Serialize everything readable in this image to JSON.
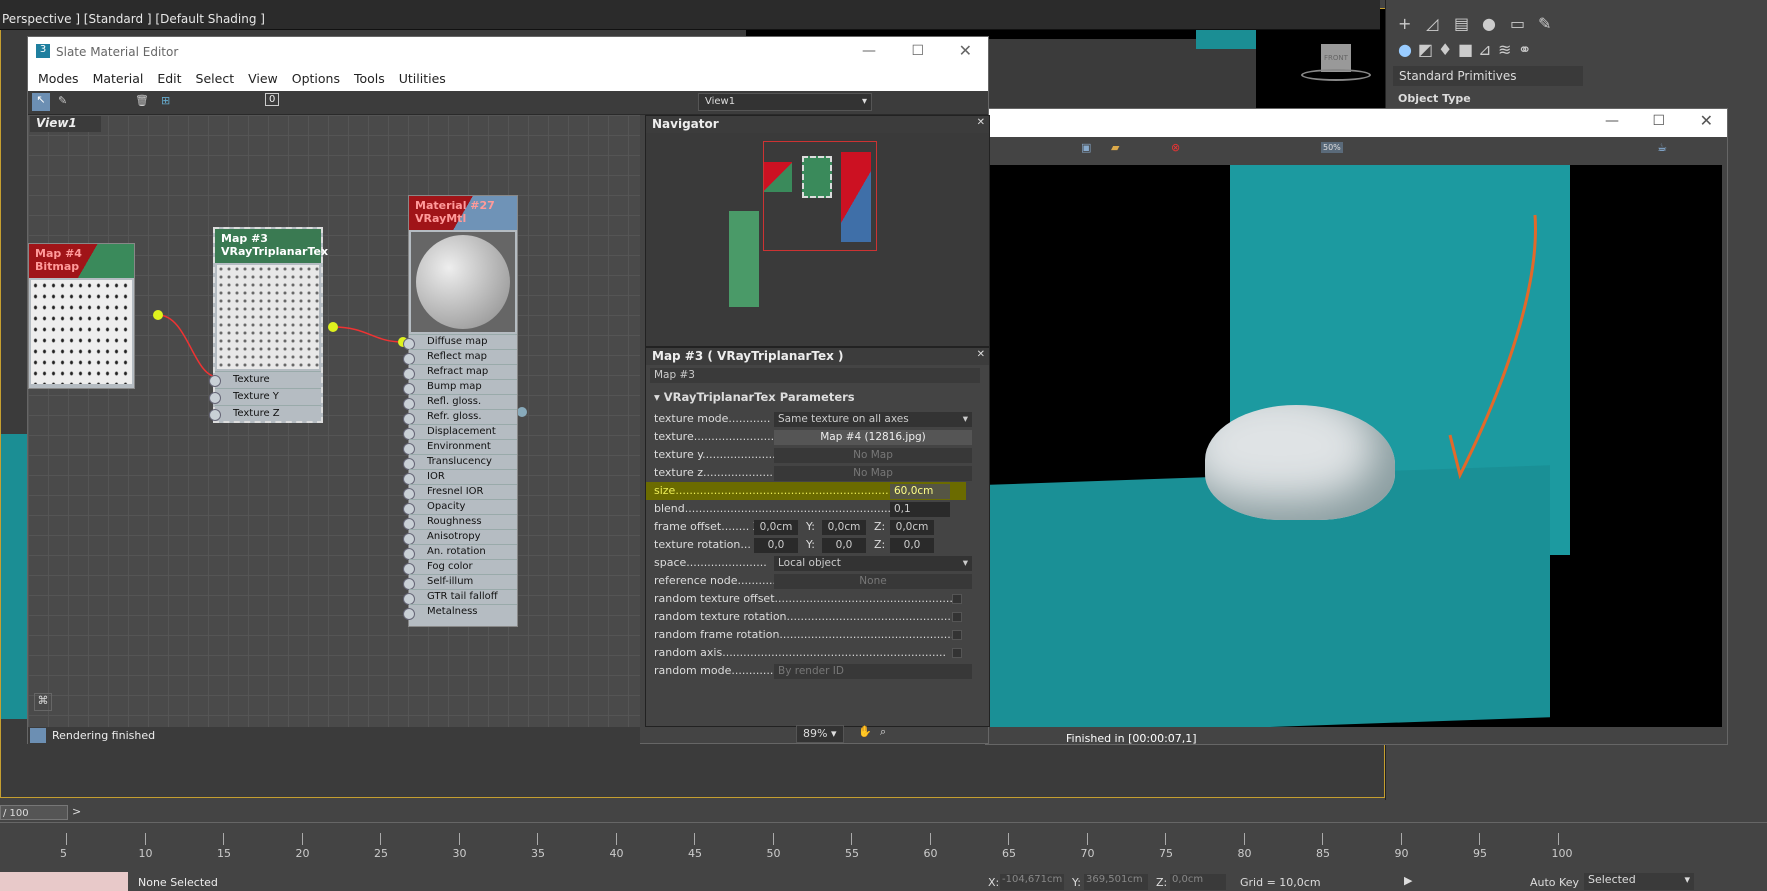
{
  "viewport": {
    "label": "Perspective ] [Standard ] [Default Shading ]",
    "viewcube": "FRONT"
  },
  "command_panel": {
    "dropdown": "Standard Primitives",
    "section": "Object Type",
    "items": [
      "e",
      "here",
      "e",
      "mid",
      "e"
    ]
  },
  "slate": {
    "title": "Slate Material Editor",
    "menu": [
      "Modes",
      "Material",
      "Edit",
      "Select",
      "View",
      "Options",
      "Tools",
      "Utilities"
    ],
    "view_select": "View1",
    "view_tab": "View1",
    "nodes": {
      "map4": {
        "l1": "Map #4",
        "l2": "Bitmap"
      },
      "map3": {
        "l1": "Map #3",
        "l2": "VRayTriplanarTex",
        "slots": [
          "Texture",
          "Texture Y",
          "Texture Z"
        ]
      },
      "mat": {
        "l1": "Material #27",
        "l2": "VRayMtl",
        "slots": [
          "Diffuse map",
          "Reflect map",
          "Refract map",
          "Bump map",
          "Refl. gloss.",
          "Refr. gloss.",
          "Displacement",
          "Environment",
          "Translucency",
          "IOR",
          "Fresnel IOR",
          "Opacity",
          "Roughness",
          "Anisotropy",
          "An. rotation",
          "Fog color",
          "Self-illum",
          "GTR tail falloff",
          "Metalness"
        ]
      }
    },
    "navigator": "Navigator",
    "params_title": "Map #3  ( VRayTriplanarTex )",
    "map_name": "Map #3",
    "rollout": "VRayTriplanarTex Parameters",
    "p": {
      "mode_l": "texture mode............",
      "mode_v": "Same texture on all axes",
      "tex_l": "texture.......................",
      "tex_v": "Map #4 (12816.jpg)",
      "ty_l": "texture y.....................",
      "ty_v": "No Map",
      "tz_l": "texture z.....................",
      "tz_v": "No Map",
      "size_l": "size.............................................................",
      "size_v": "60,0cm",
      "blend_l": "blend...........................................................",
      "blend_v": "0,1",
      "fo_l": "frame offset........ X:",
      "fo_x": "0,0cm",
      "fo_yl": "Y:",
      "fo_y": "0,0cm",
      "fo_zl": "Z:",
      "fo_z": "0,0cm",
      "tr_l": "texture rotation... X:",
      "tr_x": "0,0",
      "tr_yl": "Y:",
      "tr_y": "0,0",
      "tr_zl": "Z:",
      "tr_z": "0,0",
      "space_l": "space.......................",
      "space_v": "Local object",
      "ref_l": "reference node...........",
      "ref_v": "None",
      "rto_l": "random texture offset...................................................",
      "rtr_l": "random texture rotation...............................................",
      "rfr_l": "random frame rotation...................................................",
      "rax_l": "random axis................................................................",
      "rmode_l": "random mode..............",
      "rmode_v": "By render ID"
    },
    "status": "Rendering finished",
    "zoom": "89%"
  },
  "render": {
    "status": "Finished in [00:00:07,1]",
    "zoom_btn": "50%"
  },
  "timeline": {
    "frame": "/ 100",
    "ticks": [
      "5",
      "10",
      "15",
      "20",
      "25",
      "30",
      "35",
      "40",
      "45",
      "50",
      "55",
      "60",
      "65",
      "70",
      "75",
      "80",
      "85",
      "90",
      "95",
      "100"
    ]
  },
  "statusbar": {
    "selected": "None Selected",
    "x_l": "X:",
    "x": "-104,671cm",
    "y_l": "Y:",
    "y": "369,501cm",
    "z_l": "Z:",
    "z": "0,0cm",
    "grid": "Grid = 10,0cm",
    "autokey": "Auto Key",
    "sel": "Selected"
  },
  "colors": {
    "teal": "#1b8e94",
    "green_node": "#3a8a5b",
    "red_node": "#a01418",
    "highlight": "#6b6b00",
    "accent": "#c59f30"
  }
}
